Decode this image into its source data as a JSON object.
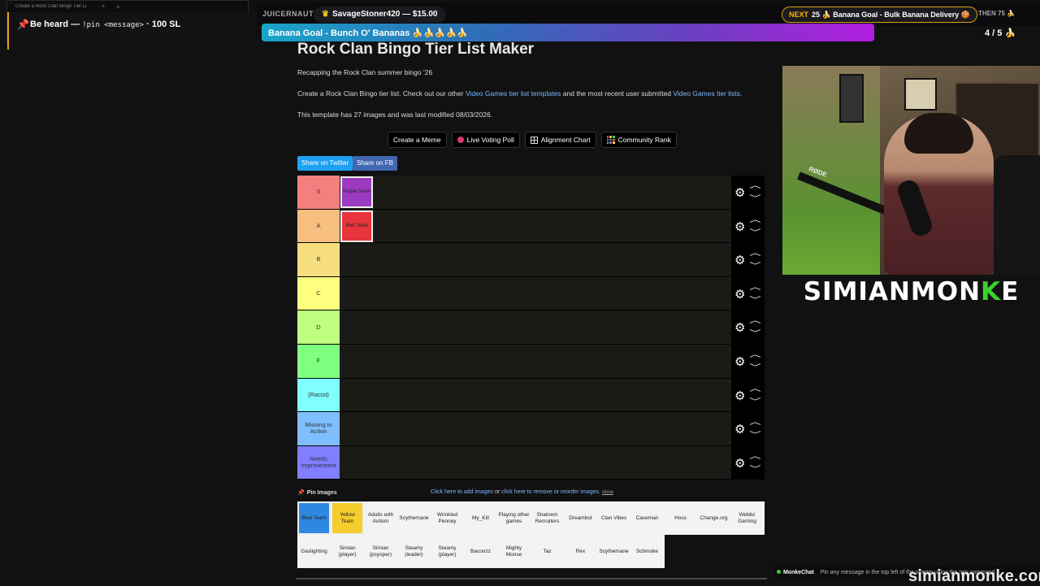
{
  "browser": {
    "tab_title": "Create a Rock Clan Bingo Tier Li"
  },
  "pin_banner": {
    "prefix": "Be heard —",
    "command": "!pin <message>",
    "suffix": "· 100 SL"
  },
  "ticker": {
    "channel": "JUICERNAUT",
    "donor": "SavageStoner420 — $15.00",
    "next_label": "NEXT",
    "next_text": "25 🍌 Banana Goal - Bulk Banana Delivery 🍪",
    "then_text": "THEN  75 🍌"
  },
  "goal": {
    "text": "Banana Goal - Bunch O' Bananas 🍌🍌🍌🍌🍌",
    "count": "4 / 5 🍌"
  },
  "page": {
    "title": "Rock Clan Bingo Tier List Maker",
    "subtitle": "Recapping the Rock Clan summer bingo '26",
    "create_prefix": "Create a Rock Clan Bingo tier list. Check out our other ",
    "create_link1": "Video Games tier list templates",
    "create_mid": " and the most recent user submitted ",
    "create_link2": "Video Games tier lists",
    "create_suffix": ".",
    "template_info": "This template has 27 images and was last modified 08/03/2026."
  },
  "buttons": {
    "create_meme": "Create a Meme",
    "live_poll": "Live Voting Poll",
    "alignment": "Alignment Chart",
    "community": "Community Rank",
    "share_twitter": "Share on Twitter",
    "share_fb": "Share on FB"
  },
  "tiers": [
    {
      "label": "S",
      "color": "#f47f7f"
    },
    {
      "label": "A",
      "color": "#f6bf7f"
    },
    {
      "label": "B",
      "color": "#f7de7f"
    },
    {
      "label": "C",
      "color": "#feff7f"
    },
    {
      "label": "D",
      "color": "#bfff7f"
    },
    {
      "label": "F",
      "color": "#7fff7f"
    },
    {
      "label": "(Racist)",
      "color": "#7fffff"
    },
    {
      "label": "Missing in Action",
      "color": "#7fbfff"
    },
    {
      "label": "Needs Improvement",
      "color": "#7f7fff"
    }
  ],
  "placed": [
    {
      "label": "Purple Team",
      "color": "#9b3bc0"
    },
    {
      "label": "Red Team",
      "color": "#e8343a"
    }
  ],
  "pool_header": {
    "pin": "Pin Images",
    "add": "Click here to add images",
    "or": " or ",
    "reorder": "click here to remove or reorder images.",
    "close": "close"
  },
  "pool_row1": [
    "Blue Team",
    "Yellow Team",
    "Adults with Autism",
    "Scythemane",
    "Wrinkled Penney",
    "My_Kill",
    "Playing other games",
    "Shatnem Recruiters",
    "Dreambot",
    "Clan Vibes",
    "Caveman",
    "Hoss",
    "Change.org",
    "Webbz Gaming"
  ],
  "pool_row2": [
    "Gaslighting",
    "Simian (player)",
    "Simian (psyoper)",
    "Steamy (leader)",
    "Steamy (player)",
    "Baconzz",
    "Mighty Moose",
    "Taz",
    "Rex",
    "Scythemane",
    "Schmoke"
  ],
  "brand": {
    "pre": "SIMIANMON",
    "k": "K",
    "post": "E"
  },
  "monkechat": {
    "name": "MonkeChat",
    "msg": "Pin any message in the top left of the stream using the !pin command"
  },
  "watermark": "simianmonke.com",
  "colors": {
    "twitter": "#1da1f2",
    "facebook": "#4267b2",
    "blue_team": "#2f88e0",
    "yellow_team": "#f5cd2d",
    "accent_green": "#39d12f"
  }
}
